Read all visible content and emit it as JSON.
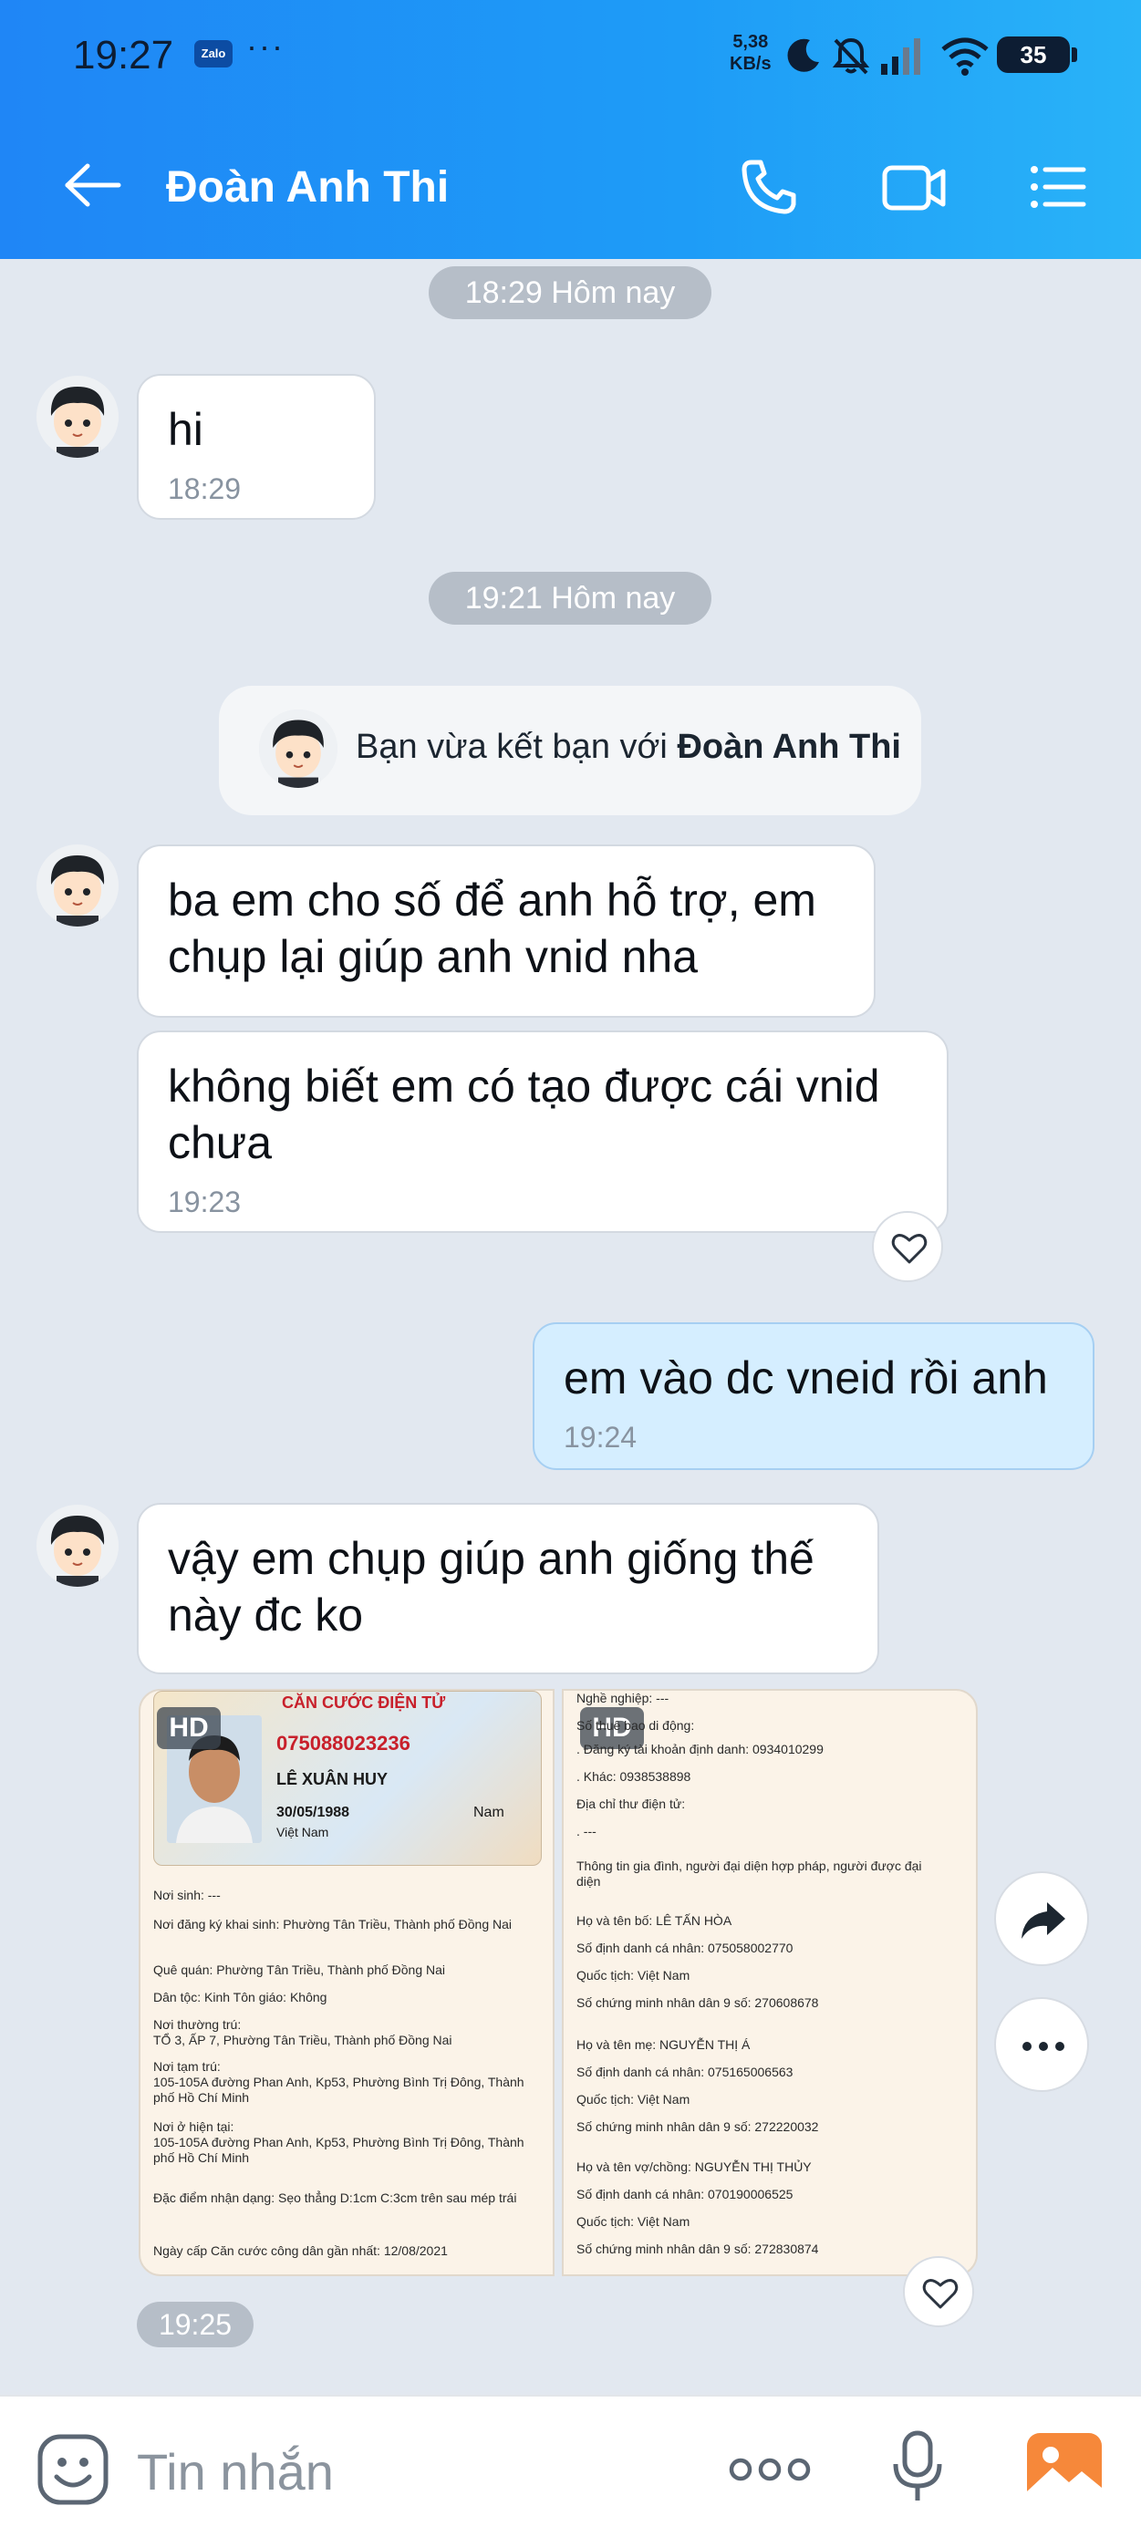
{
  "status_bar": {
    "time": "19:27",
    "zalo_badge": "Zalo",
    "dots": "···",
    "net_speed_value": "5,38",
    "net_speed_unit": "KB/s",
    "battery": "35"
  },
  "header": {
    "title": "Đoàn Anh Thi",
    "icons": [
      "back-arrow-icon",
      "phone-icon",
      "video-call-icon",
      "menu-list-icon"
    ]
  },
  "conversation": {
    "dividers": [
      {
        "label": "18:29 Hôm nay"
      },
      {
        "label": "19:21 Hôm nay"
      }
    ],
    "messages": [
      {
        "text": "hi",
        "time": "18:29"
      },
      {
        "text": "ba em cho số để anh hỗ trợ, em chụp lại giúp anh vnid nha"
      },
      {
        "text": "không biết em có tạo được cái vnid chưa",
        "time": "19:23"
      },
      {
        "text": "em vào dc vneid rồi anh",
        "time": "19:24"
      },
      {
        "text": "vậy em chụp giúp anh giống thế này đc ko"
      }
    ],
    "system_message": {
      "prefix": "Bạn vừa kết bạn với ",
      "name": "Đoàn Anh Thi"
    },
    "image_time": "19:25",
    "hd_label": "HD",
    "id_card": {
      "title": "CĂN CƯỚC ĐIỆN TỬ",
      "id_number": "075088023236",
      "name": "LÊ XUÂN HUY",
      "dob": "30/05/1988",
      "sex": "Nam",
      "nationality": "Việt Nam",
      "lines": [
        "Nơi sinh: ---",
        "Nơi đăng ký khai sinh: Phường Tân Triều, Thành phố Đồng Nai",
        "Quê quán: Phường Tân Triều, Thành phố Đồng Nai",
        "Dân tộc: Kinh          Tôn giáo: Không",
        "Nơi thường trú:",
        "TỔ 3, ẤP 7, Phường Tân Triều, Thành phố Đồng Nai",
        "Nơi tạm trú:",
        "105-105A đường Phan Anh, Kp53, Phường Bình Trị Đông, Thành phố Hồ Chí Minh",
        "Nơi ở hiện tại:",
        "105-105A đường Phan Anh, Kp53, Phường Bình Trị Đông, Thành phố Hồ Chí Minh",
        "Đặc điểm nhận dạng: Sẹo thẳng D:1cm C:3cm trên sau mép trái",
        "Ngày cấp Căn cước công dân gần nhất: 12/08/2021"
      ]
    },
    "family_info": {
      "lines": [
        "Nghề nghiệp: ---",
        "Số thuê bao di động:",
        ". Đăng ký tài khoản định danh: 0934010299",
        ". Khác: 0938538898",
        "Địa chỉ thư điện tử:",
        ". ---",
        "Thông tin gia đình, người đại diện hợp pháp, người được đại diện",
        "Họ và tên bố: LÊ TẤN HÒA",
        "Số định danh cá nhân: 075058002770",
        "Quốc tịch: Việt Nam",
        "Số chứng minh nhân dân 9 số: 270608678",
        "Họ và tên mẹ: NGUYỄN THỊ Á",
        "Số định danh cá nhân: 075165006563",
        "Quốc tịch: Việt Nam",
        "Số chứng minh nhân dân 9 số: 272220032",
        "Họ và tên vợ/chồng: NGUYỄN THỊ THỦY",
        "Số định danh cá nhân: 070190006525",
        "Quốc tịch: Việt Nam",
        "Số chứng minh nhân dân 9 số: 272830874"
      ]
    }
  },
  "composer": {
    "placeholder": "Tin nhắn",
    "icons": [
      "emoji-icon",
      "more-dots-icon",
      "microphone-icon",
      "gallery-icon"
    ]
  },
  "colors": {
    "header_start": "#1f86f6",
    "header_end": "#29b3f8",
    "my_bubble": "#d5eeff",
    "chat_bg": "#e2e8f0"
  }
}
